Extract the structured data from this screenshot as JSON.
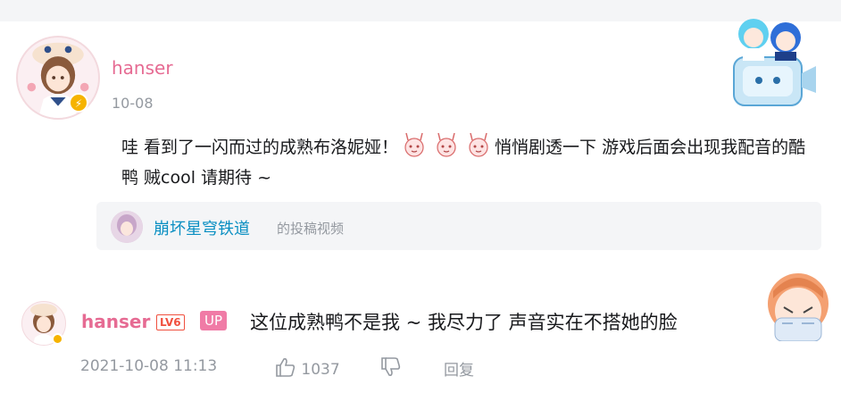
{
  "main_comment": {
    "username": "hanser",
    "date": "10-08",
    "text_before_emoji": "哇 看到了一闪而过的成熟布洛妮娅！",
    "text_after_emoji": "悄悄剧透一下 游戏后面会出现我配音的酷鸭 贼cool 请期待 ~",
    "emoji": [
      "rabbit-face-emoji",
      "rabbit-face-emoji",
      "rabbit-face-emoji"
    ]
  },
  "source": {
    "title": "崩坏星穹铁道",
    "tag": "的投稿视频"
  },
  "reply": {
    "username": "hanser",
    "level": "LV6",
    "up_badge": "UP",
    "text": "这位成熟鸭不是我 ~ 我尽力了 声音实在不搭她的脸",
    "timestamp": "2021-10-08 11:13",
    "likes": "1037",
    "reply_label": "回复"
  },
  "colors": {
    "username": "#e66b93",
    "link": "#0a8fc2",
    "meta": "#9499a0",
    "level": "#f0503f",
    "up": "#f07ba6"
  }
}
